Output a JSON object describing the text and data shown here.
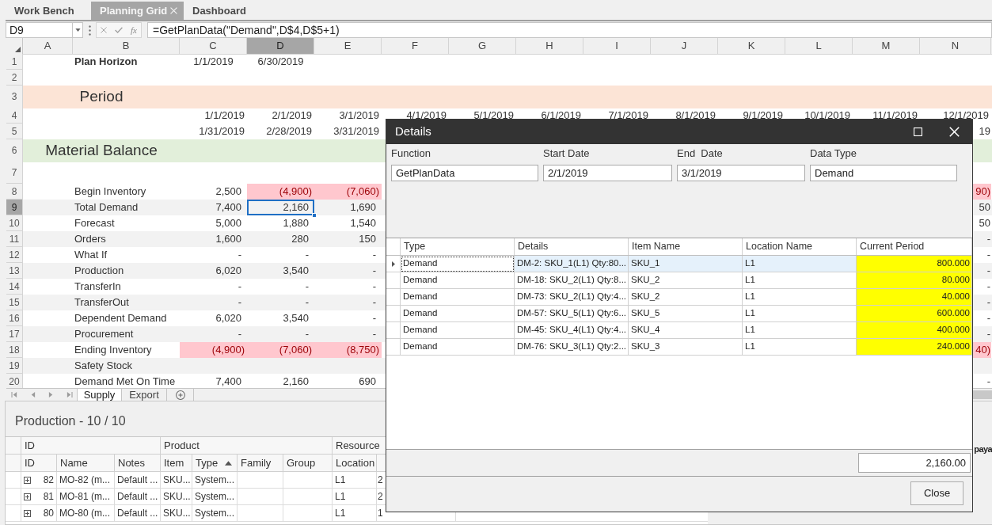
{
  "tabs": [
    {
      "label": "Work Bench",
      "selected": false,
      "closable": false
    },
    {
      "label": "Planning Grid",
      "selected": true,
      "closable": true
    },
    {
      "label": "Dashboard",
      "selected": false,
      "closable": false
    }
  ],
  "formula_bar": {
    "cell_reference": "D9",
    "function_button": "fx",
    "formula": "=GetPlanData(\"Demand\",D$4,D$5+1)"
  },
  "sheet": {
    "columns": [
      {
        "label": "A",
        "selected": false
      },
      {
        "label": "B",
        "selected": false
      },
      {
        "label": "C",
        "selected": false
      },
      {
        "label": "D",
        "selected": true
      },
      {
        "label": "E",
        "selected": false
      },
      {
        "label": "F",
        "selected": false
      },
      {
        "label": "G",
        "selected": false
      },
      {
        "label": "H",
        "selected": false
      },
      {
        "label": "I",
        "selected": false
      },
      {
        "label": "J",
        "selected": false
      },
      {
        "label": "K",
        "selected": false
      },
      {
        "label": "L",
        "selected": false
      },
      {
        "label": "M",
        "selected": false
      },
      {
        "label": "N",
        "selected": false
      }
    ],
    "rows": [
      {
        "number": "1",
        "selected": false,
        "kind": "horizon",
        "label": "Plan Horizon",
        "cells": [
          {
            "text": "1/1/2019",
            "selected": false
          },
          {
            "text": "6/30/2019",
            "selected": false
          }
        ]
      },
      {
        "number": "2",
        "selected": false,
        "kind": "blank"
      },
      {
        "number": "3",
        "selected": false,
        "kind": "section",
        "label": "Period",
        "color": "#fce4d6"
      },
      {
        "number": "4",
        "selected": false,
        "kind": "dates",
        "cells": [
          {
            "text": "1/1/2019",
            "selected": false
          },
          {
            "text": "2/1/2019",
            "selected": false
          },
          {
            "text": "3/1/2019",
            "selected": false
          },
          {
            "text": "4/1/2019",
            "selected": false
          },
          {
            "text": "5/1/2019",
            "selected": false
          },
          {
            "text": "6/1/2019",
            "selected": false
          },
          {
            "text": "7/1/2019",
            "selected": false
          },
          {
            "text": "8/1/2019",
            "selected": false
          },
          {
            "text": "9/1/2019",
            "selected": false
          },
          {
            "text": "10/1/2019",
            "selected": false
          },
          {
            "text": "11/1/2019",
            "selected": false
          },
          {
            "text": "12/1/2019",
            "selected": false
          }
        ]
      },
      {
        "number": "5",
        "selected": false,
        "kind": "dates",
        "cells": [
          {
            "text": "1/31/2019",
            "selected": false
          },
          {
            "text": "2/28/2019",
            "selected": false
          },
          {
            "text": "3/31/2019",
            "selected": false
          }
        ],
        "edge": {
          "text": "19"
        }
      },
      {
        "number": "6",
        "selected": false,
        "kind": "section",
        "label": "Material Balance",
        "color": "#e2efda"
      },
      {
        "number": "7",
        "selected": false,
        "kind": "blank"
      },
      {
        "number": "8",
        "selected": false,
        "kind": "metric",
        "label": "Begin Inventory",
        "cells": [
          {
            "text": "2,500",
            "negative": false,
            "selected": false
          },
          {
            "text": "(4,900)",
            "negative": true,
            "selected": false
          },
          {
            "text": "(7,060)",
            "negative": true,
            "selected": false
          }
        ],
        "edge": {
          "text": "90)",
          "negative": true
        }
      },
      {
        "number": "9",
        "selected": true,
        "kind": "metric",
        "label": "Total Demand",
        "cells": [
          {
            "text": "7,400",
            "negative": false,
            "selected": false
          },
          {
            "text": "2,160",
            "negative": false,
            "selected": true
          },
          {
            "text": "1,690",
            "negative": false,
            "selected": false
          }
        ],
        "edge": {
          "text": "50",
          "negative": false
        }
      },
      {
        "number": "10",
        "selected": false,
        "kind": "metric",
        "label": "Forecast",
        "cells": [
          {
            "text": "5,000",
            "negative": false,
            "selected": false
          },
          {
            "text": "1,880",
            "negative": false,
            "selected": false
          },
          {
            "text": "1,540",
            "negative": false,
            "selected": false
          }
        ],
        "edge": {
          "text": "50",
          "negative": false
        }
      },
      {
        "number": "11",
        "selected": false,
        "kind": "metric",
        "label": "Orders",
        "cells": [
          {
            "text": "1,600",
            "negative": false,
            "selected": false
          },
          {
            "text": "280",
            "negative": false,
            "selected": false
          },
          {
            "text": "150",
            "negative": false,
            "selected": false
          }
        ],
        "edge": {
          "text": "-",
          "negative": false
        }
      },
      {
        "number": "12",
        "selected": false,
        "kind": "metric",
        "label": "What If",
        "cells": [
          {
            "text": "-",
            "negative": false,
            "selected": false
          },
          {
            "text": "-",
            "negative": false,
            "selected": false
          },
          {
            "text": "-",
            "negative": false,
            "selected": false
          }
        ],
        "edge": {
          "text": "-",
          "negative": false
        }
      },
      {
        "number": "13",
        "selected": false,
        "kind": "metric",
        "label": "Production",
        "cells": [
          {
            "text": "6,020",
            "negative": false,
            "selected": false
          },
          {
            "text": "3,540",
            "negative": false,
            "selected": false
          },
          {
            "text": "-",
            "negative": false,
            "selected": false
          }
        ],
        "edge": {
          "text": "-",
          "negative": false
        }
      },
      {
        "number": "14",
        "selected": false,
        "kind": "metric",
        "label": "TransferIn",
        "cells": [
          {
            "text": "-",
            "negative": false,
            "selected": false
          },
          {
            "text": "-",
            "negative": false,
            "selected": false
          },
          {
            "text": "-",
            "negative": false,
            "selected": false
          }
        ],
        "edge": {
          "text": "-",
          "negative": false
        }
      },
      {
        "number": "15",
        "selected": false,
        "kind": "metric",
        "label": "TransferOut",
        "cells": [
          {
            "text": "-",
            "negative": false,
            "selected": false
          },
          {
            "text": "-",
            "negative": false,
            "selected": false
          },
          {
            "text": "-",
            "negative": false,
            "selected": false
          }
        ],
        "edge": {
          "text": "-",
          "negative": false
        }
      },
      {
        "number": "16",
        "selected": false,
        "kind": "metric",
        "label": "Dependent Demand",
        "cells": [
          {
            "text": "6,020",
            "negative": false,
            "selected": false
          },
          {
            "text": "3,540",
            "negative": false,
            "selected": false
          },
          {
            "text": "-",
            "negative": false,
            "selected": false
          }
        ],
        "edge": {
          "text": "-",
          "negative": false
        }
      },
      {
        "number": "17",
        "selected": false,
        "kind": "metric",
        "label": "Procurement",
        "cells": [
          {
            "text": "-",
            "negative": false,
            "selected": false
          },
          {
            "text": "-",
            "negative": false,
            "selected": false
          },
          {
            "text": "-",
            "negative": false,
            "selected": false
          }
        ],
        "edge": {
          "text": "-",
          "negative": false
        }
      },
      {
        "number": "18",
        "selected": false,
        "kind": "metric",
        "label": "Ending Inventory",
        "cells": [
          {
            "text": "(4,900)",
            "negative": true,
            "selected": false
          },
          {
            "text": "(7,060)",
            "negative": true,
            "selected": false
          },
          {
            "text": "(8,750)",
            "negative": true,
            "selected": false
          }
        ],
        "edge": {
          "text": "40)",
          "negative": true
        }
      },
      {
        "number": "19",
        "selected": false,
        "kind": "metric",
        "label": "Safety Stock"
      },
      {
        "number": "20",
        "selected": false,
        "kind": "metric",
        "label": "Demand Met On Time",
        "cells": [
          {
            "text": "7,400",
            "negative": false,
            "selected": false
          },
          {
            "text": "2,160",
            "negative": false,
            "selected": false
          },
          {
            "text": "690",
            "negative": false,
            "selected": false
          }
        ],
        "edge": {
          "text": "-",
          "negative": false
        }
      }
    ]
  },
  "sheet_tabs": [
    {
      "label": "Supply",
      "selected": true
    },
    {
      "label": "Export",
      "selected": false
    }
  ],
  "production_panel": {
    "title": "Production - 10 / 10",
    "column_groups": [
      {
        "label": "ID"
      },
      {
        "label": "Product"
      },
      {
        "label": "Resource"
      }
    ],
    "columns": [
      {
        "label": "ID",
        "sorted": false
      },
      {
        "label": "Name",
        "sorted": false
      },
      {
        "label": "Notes",
        "sorted": false
      },
      {
        "label": "Item",
        "sorted": false
      },
      {
        "label": "Type",
        "sorted": true
      },
      {
        "label": "Family",
        "sorted": false
      },
      {
        "label": "Group",
        "sorted": false
      },
      {
        "label": "Location",
        "sorted": false
      }
    ],
    "rows": [
      {
        "expanded": false,
        "id": "82",
        "name": "MO-82 (m...",
        "notes": "Default ...",
        "item": "SKU...",
        "type": "System...",
        "location": "L1",
        "column_9": "2"
      },
      {
        "expanded": false,
        "id": "81",
        "name": "MO-81 (m...",
        "notes": "Default ...",
        "item": "SKU...",
        "type": "System...",
        "location": "L1",
        "column_9": "2"
      },
      {
        "expanded": false,
        "id": "80",
        "name": "MO-80 (m...",
        "notes": "Default ...",
        "item": "SKU...",
        "type": "System...",
        "location": "L1",
        "column_9": "1"
      }
    ],
    "side_heading": "paya"
  },
  "details_dialog": {
    "title": "Details",
    "fields": [
      {
        "label": "Function",
        "value": "GetPlanData"
      },
      {
        "label": "Start Date",
        "value": "2/1/2019"
      },
      {
        "label": "End  Date",
        "value": "3/1/2019"
      },
      {
        "label": "Data Type",
        "value": "Demand"
      }
    ],
    "table": {
      "columns": [
        {
          "label": "Type"
        },
        {
          "label": "Details"
        },
        {
          "label": "Item Name"
        },
        {
          "label": "Location Name"
        },
        {
          "label": "Current Period"
        }
      ],
      "rows": [
        {
          "selected": true,
          "type": "Demand",
          "details": "DM-2: SKU_1(L1) Qty:80...",
          "item_name": "SKU_1",
          "location_name": "L1",
          "current_period": "800.000"
        },
        {
          "selected": false,
          "type": "Demand",
          "details": "DM-18: SKU_2(L1) Qty:8...",
          "item_name": "SKU_2",
          "location_name": "L1",
          "current_period": "80.000"
        },
        {
          "selected": false,
          "type": "Demand",
          "details": "DM-73: SKU_2(L1) Qty:4...",
          "item_name": "SKU_2",
          "location_name": "L1",
          "current_period": "40.000"
        },
        {
          "selected": false,
          "type": "Demand",
          "details": "DM-57: SKU_5(L1) Qty:6...",
          "item_name": "SKU_5",
          "location_name": "L1",
          "current_period": "600.000"
        },
        {
          "selected": false,
          "type": "Demand",
          "details": "DM-45: SKU_4(L1) Qty:4...",
          "item_name": "SKU_4",
          "location_name": "L1",
          "current_period": "400.000"
        },
        {
          "selected": false,
          "type": "Demand",
          "details": "DM-76: SKU_3(L1) Qty:2...",
          "item_name": "SKU_3",
          "location_name": "L1",
          "current_period": "240.000"
        }
      ]
    },
    "total": "2,160.00",
    "close_button": "Close"
  }
}
